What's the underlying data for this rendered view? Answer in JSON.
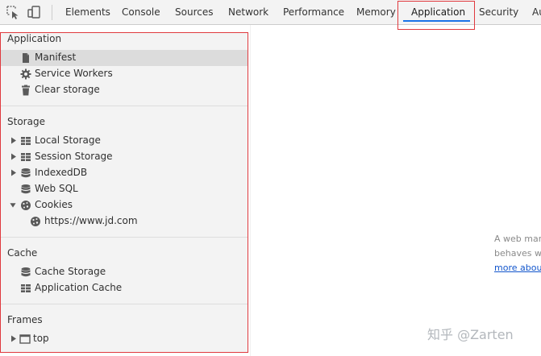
{
  "toolbar": {
    "icons": [
      "inspect-element-icon",
      "device-toolbar-icon"
    ],
    "tabs": [
      "Elements",
      "Console",
      "Sources",
      "Network",
      "Performance",
      "Memory",
      "Application",
      "Security",
      "Au"
    ],
    "active_tab": "Application"
  },
  "sidebar": {
    "application": {
      "title": "Application",
      "items": [
        {
          "label": "Manifest",
          "icon": "document-icon"
        },
        {
          "label": "Service Workers",
          "icon": "gear-icon"
        },
        {
          "label": "Clear storage",
          "icon": "trash-icon"
        }
      ]
    },
    "storage": {
      "title": "Storage",
      "items": [
        {
          "label": "Local Storage",
          "icon": "grid-icon"
        },
        {
          "label": "Session Storage",
          "icon": "grid-icon"
        },
        {
          "label": "IndexedDB",
          "icon": "database-icon"
        },
        {
          "label": "Web SQL",
          "icon": "database-icon"
        },
        {
          "label": "Cookies",
          "icon": "cookie-icon"
        },
        {
          "label": "https://www.jd.com",
          "icon": "cookie-icon"
        }
      ]
    },
    "cache": {
      "title": "Cache",
      "items": [
        {
          "label": "Cache Storage",
          "icon": "database-icon"
        },
        {
          "label": "Application Cache",
          "icon": "grid-icon"
        }
      ]
    },
    "frames": {
      "title": "Frames",
      "items": [
        {
          "label": "top",
          "icon": "frame-icon"
        }
      ]
    }
  },
  "main": {
    "line1": "A web man",
    "line2": "behaves wh",
    "link": "more abou"
  },
  "watermark": "知乎 @Zarten",
  "colors": {
    "highlight_border": "#e0393e",
    "active_underline": "#1a73e8",
    "selected_row": "#dcdcdc"
  }
}
